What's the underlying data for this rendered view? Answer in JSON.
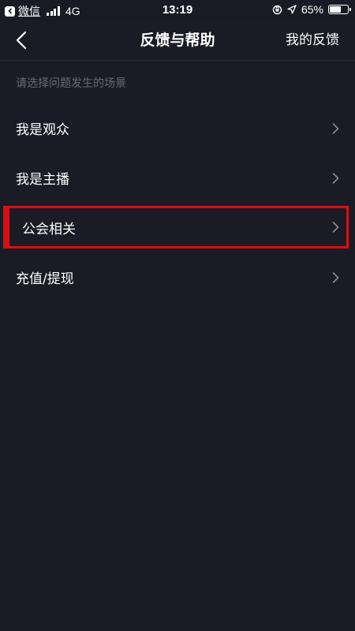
{
  "status_bar": {
    "app": "微信",
    "network": "4G",
    "time": "13:19",
    "battery": "65%",
    "battery_level": 0.65
  },
  "nav": {
    "title": "反馈与帮助",
    "right_link": "我的反馈"
  },
  "section_hint": "请选择问题发生的场景",
  "menu": [
    {
      "label": "我是观众"
    },
    {
      "label": "我是主播"
    },
    {
      "label": "公会相关",
      "highlighted": true
    },
    {
      "label": "充值/提现"
    }
  ],
  "colors": {
    "background": "#1b1b25",
    "highlight_border": "#d60f14",
    "hint_text": "#6b6b78"
  }
}
